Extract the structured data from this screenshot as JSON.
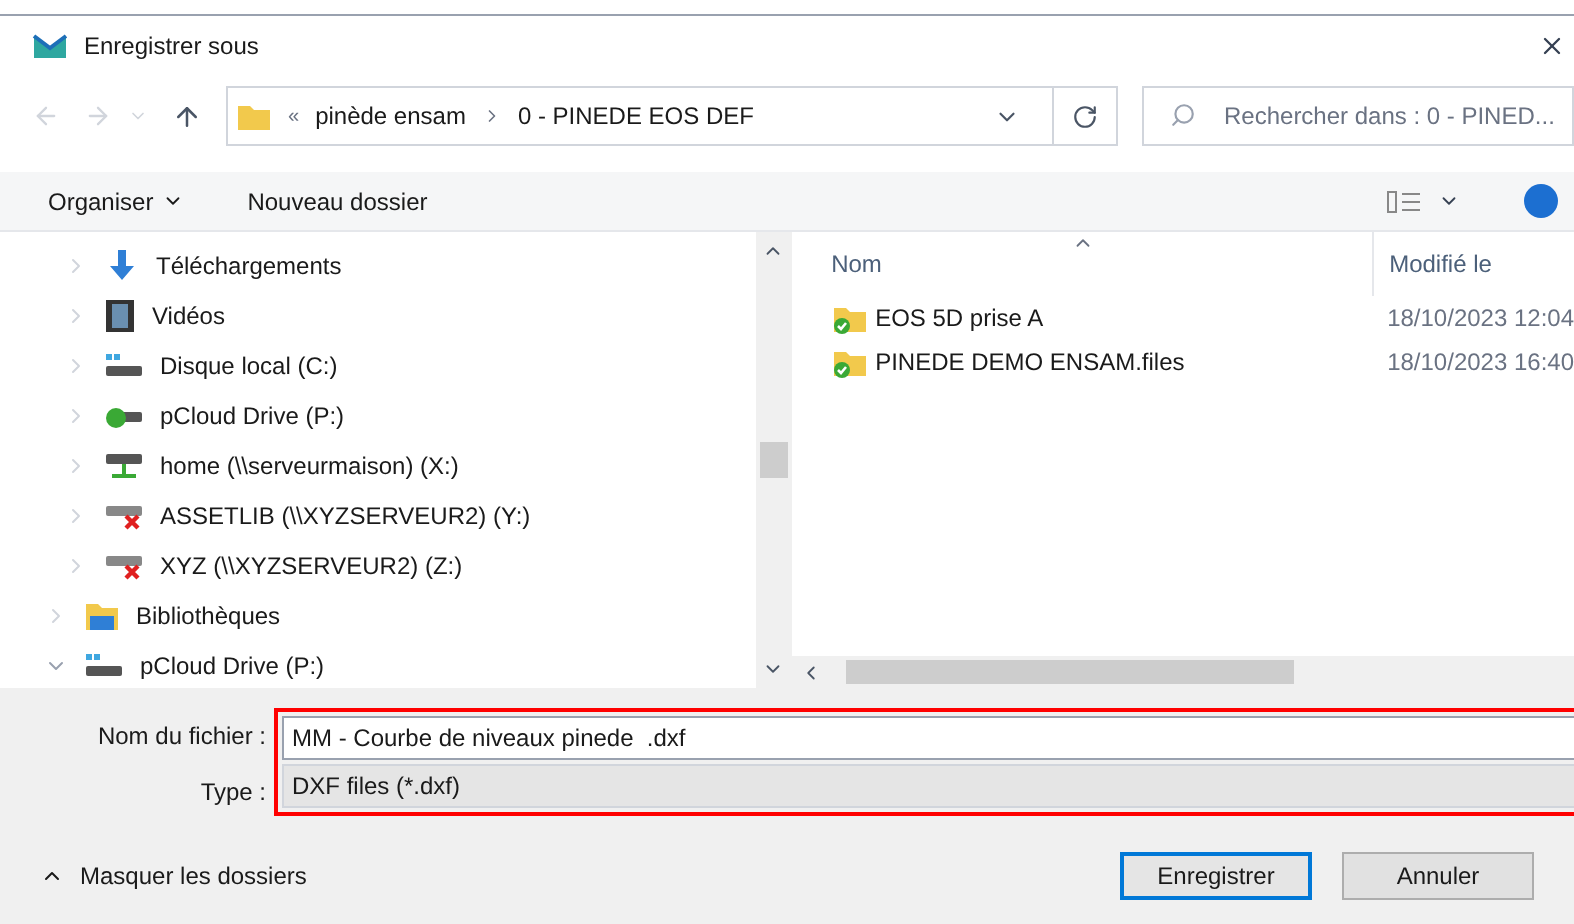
{
  "window": {
    "title": "Enregistrer sous"
  },
  "address": {
    "overflow": "«",
    "crumbs": [
      "pinède ensam",
      "0 - PINEDE EOS DEF"
    ]
  },
  "search": {
    "placeholder": "Rechercher dans : 0 - PINED..."
  },
  "toolbar": {
    "organize": "Organiser",
    "new_folder": "Nouveau dossier"
  },
  "tree": {
    "sub_items": [
      {
        "label": "Téléchargements",
        "kind": "download",
        "expanded": false
      },
      {
        "label": "Vidéos",
        "kind": "video",
        "expanded": false
      },
      {
        "label": "Disque local (C:)",
        "kind": "disk",
        "expanded": false
      },
      {
        "label": "pCloud Drive (P:)",
        "kind": "cloud",
        "expanded": false
      },
      {
        "label": "home (\\\\serveurmaison) (X:)",
        "kind": "network",
        "expanded": false
      },
      {
        "label": "ASSETLIB (\\\\XYZSERVEUR2) (Y:)",
        "kind": "network-off",
        "expanded": false
      },
      {
        "label": "XYZ (\\\\XYZSERVEUR2) (Z:)",
        "kind": "network-off",
        "expanded": false
      }
    ],
    "items": [
      {
        "label": "Bibliothèques",
        "kind": "library",
        "expanded": false
      },
      {
        "label": "pCloud Drive (P:)",
        "kind": "disk",
        "expanded": true
      }
    ]
  },
  "table": {
    "columns": [
      "Nom",
      "Modifié le"
    ],
    "rows": [
      {
        "name": "EOS 5D prise A",
        "modified": "18/10/2023 12:04"
      },
      {
        "name": "PINEDE DEMO ENSAM.files",
        "modified": "18/10/2023 16:40"
      }
    ]
  },
  "form": {
    "filename_label": "Nom du fichier :",
    "filename": "MM - Courbe de niveaux pinede  .dxf",
    "type_label": "Type :",
    "type": "DXF files (*.dxf)"
  },
  "hide_folders": "Masquer les dossiers",
  "buttons": [
    "Enregistrer",
    "Annuler"
  ]
}
